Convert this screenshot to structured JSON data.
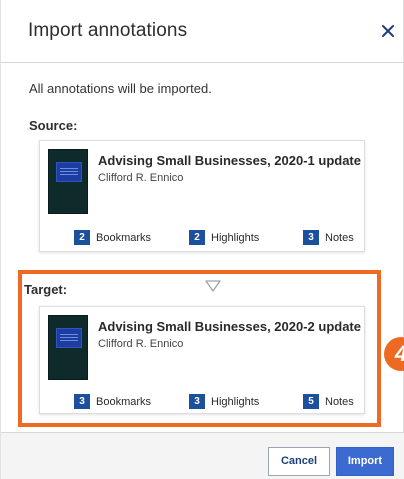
{
  "dialog": {
    "title": "Import annotations",
    "info_text": "All annotations will be imported."
  },
  "source": {
    "label": "Source:",
    "book_title": "Advising Small Businesses, 2020-1 update",
    "author": "Clifford R. Ennico",
    "stats": [
      {
        "count": "2",
        "label": "Bookmarks"
      },
      {
        "count": "2",
        "label": "Highlights"
      },
      {
        "count": "3",
        "label": "Notes"
      }
    ]
  },
  "target": {
    "label": "Target:",
    "book_title": "Advising Small Businesses, 2020-2 update",
    "author": "Clifford R. Ennico",
    "stats": [
      {
        "count": "3",
        "label": "Bookmarks"
      },
      {
        "count": "3",
        "label": "Highlights"
      },
      {
        "count": "5",
        "label": "Notes"
      }
    ]
  },
  "step_marker": "4",
  "buttons": {
    "cancel": "Cancel",
    "import": "Import"
  },
  "icons": {
    "close": "close-icon",
    "arrow": "down-arrow-icon"
  },
  "colors": {
    "accent": "#3b6ad1",
    "highlight": "#ee6a22",
    "badge": "#1c4f9c"
  }
}
